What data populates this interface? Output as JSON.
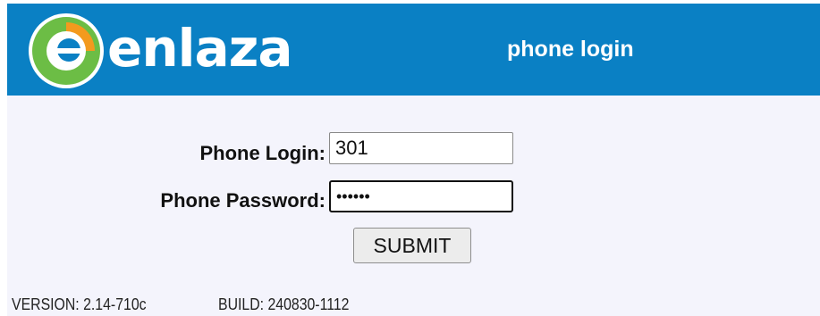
{
  "header": {
    "logo_text": "enlaza",
    "title": "phone login",
    "brand_color": "#0a80c4",
    "logo_colors": {
      "green": "#6cbd45",
      "orange": "#f39a1e",
      "white": "#ffffff"
    }
  },
  "form": {
    "login_label": "Phone Login:",
    "login_value": "301",
    "password_label": "Phone Password:",
    "password_value": "••••••",
    "submit_label": "SUBMIT"
  },
  "footer": {
    "version": "VERSION: 2.14-710c",
    "build": "BUILD: 240830-1112"
  }
}
